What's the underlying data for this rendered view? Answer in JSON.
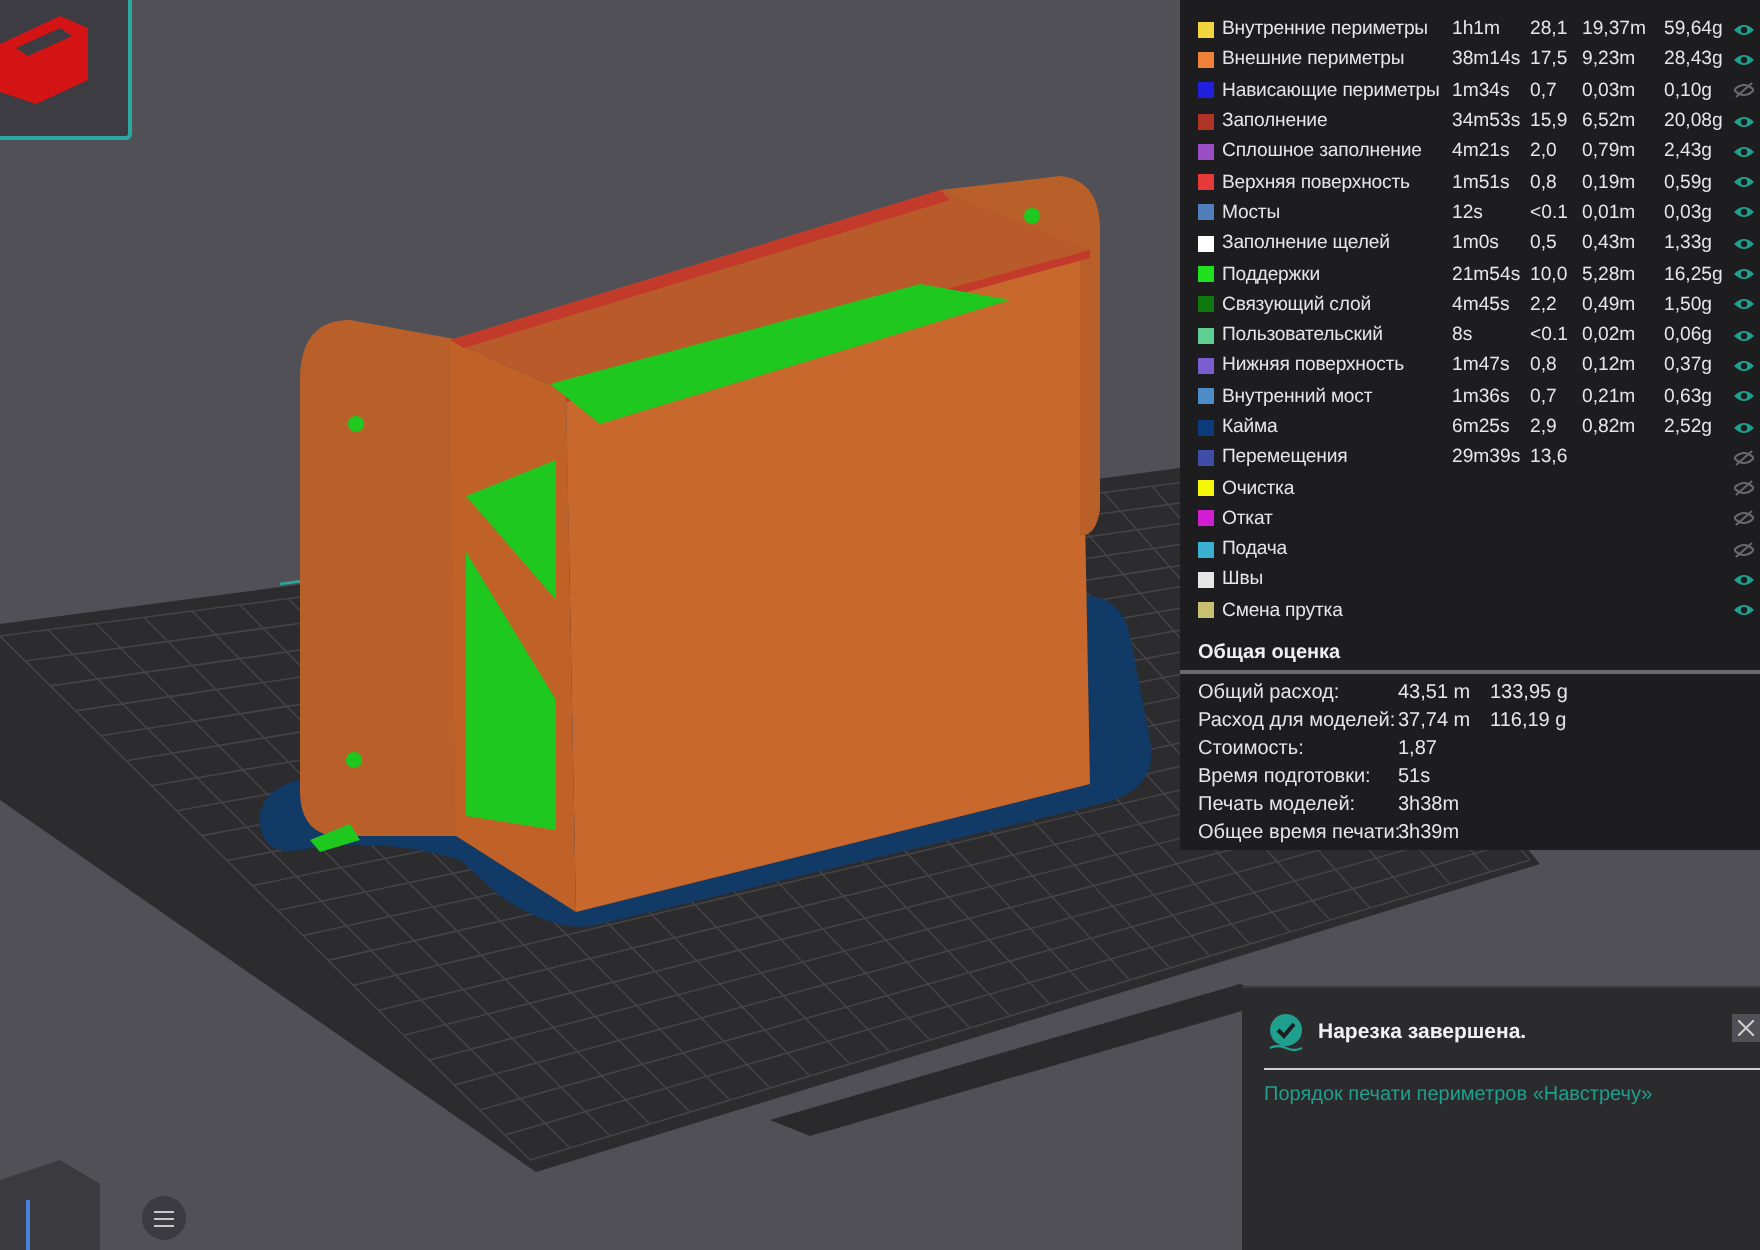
{
  "legend": {
    "rows": [
      {
        "name": "Внутренние периметры",
        "color": "#f2d43c",
        "time": "1h1m",
        "percent": "28,1",
        "length": "19,37m",
        "weight": "59,64g",
        "visible": true
      },
      {
        "name": "Внешние периметры",
        "color": "#f0823c",
        "time": "38m14s",
        "percent": "17,5",
        "length": "9,23m",
        "weight": "28,43g",
        "visible": true
      },
      {
        "name": "Нависающие периметры",
        "color": "#1f1fe0",
        "time": "1m34s",
        "percent": "0,7",
        "length": "0,03m",
        "weight": "0,10g",
        "visible": false
      },
      {
        "name": "Заполнение",
        "color": "#b03328",
        "time": "34m53s",
        "percent": "15,9",
        "length": "6,52m",
        "weight": "20,08g",
        "visible": true
      },
      {
        "name": "Сплошное заполнение",
        "color": "#9a4ec4",
        "time": "4m21s",
        "percent": "2,0",
        "length": "0,79m",
        "weight": "2,43g",
        "visible": true
      },
      {
        "name": "Верхняя поверхность",
        "color": "#e63a3a",
        "time": "1m51s",
        "percent": "0,8",
        "length": "0,19m",
        "weight": "0,59g",
        "visible": true
      },
      {
        "name": "Мосты",
        "color": "#4f7fb8",
        "time": "12s",
        "percent": "<0.1",
        "length": "0,01m",
        "weight": "0,03g",
        "visible": true
      },
      {
        "name": "Заполнение щелей",
        "color": "#ffffff",
        "time": "1m0s",
        "percent": "0,5",
        "length": "0,43m",
        "weight": "1,33g",
        "visible": true
      },
      {
        "name": "Поддержки",
        "color": "#1ee01e",
        "time": "21m54s",
        "percent": "10,0",
        "length": "5,28m",
        "weight": "16,25g",
        "visible": true
      },
      {
        "name": "Связующий слой",
        "color": "#0f7a0f",
        "time": "4m45s",
        "percent": "2,2",
        "length": "0,49m",
        "weight": "1,50g",
        "visible": true
      },
      {
        "name": "Пользовательский",
        "color": "#5ecf8e",
        "time": "8s",
        "percent": "<0.1",
        "length": "0,02m",
        "weight": "0,06g",
        "visible": true
      },
      {
        "name": "Нижняя поверхность",
        "color": "#7a5ed0",
        "time": "1m47s",
        "percent": "0,8",
        "length": "0,12m",
        "weight": "0,37g",
        "visible": true
      },
      {
        "name": "Внутренний мост",
        "color": "#4d8cc8",
        "time": "1m36s",
        "percent": "0,7",
        "length": "0,21m",
        "weight": "0,63g",
        "visible": true
      },
      {
        "name": "Кайма",
        "color": "#0d3a78",
        "time": "6m25s",
        "percent": "2,9",
        "length": "0,82m",
        "weight": "2,52g",
        "visible": true
      },
      {
        "name": "Перемещения",
        "color": "#3e4ea8",
        "time": "29m39s",
        "percent": "13,6",
        "visible": false
      },
      {
        "name": "Очистка",
        "color": "#f5f50a",
        "visible": false
      },
      {
        "name": "Откат",
        "color": "#d21ed2",
        "visible": false
      },
      {
        "name": "Подача",
        "color": "#3ab0d0",
        "visible": false
      },
      {
        "name": "Швы",
        "color": "#e6e6e6",
        "visible": true
      },
      {
        "name": "Смена прутка",
        "color": "#c8c070",
        "visible": true
      }
    ]
  },
  "summary": {
    "title": "Общая оценка",
    "rows": [
      {
        "label": "Общий расход:",
        "values": [
          "43,51 m",
          "133,95 g"
        ]
      },
      {
        "label": "Расход для моделей:",
        "values": [
          "37,74 m",
          "116,19 g"
        ]
      },
      {
        "label": "Стоимость:",
        "values": [
          "1,87"
        ]
      },
      {
        "label": "Время подготовки:",
        "values": [
          "51s"
        ]
      },
      {
        "label": "Печать моделей:",
        "values": [
          "3h38m"
        ]
      },
      {
        "label": "Общее время печати:",
        "values": [
          "3h39m"
        ]
      }
    ]
  },
  "notification": {
    "title": "Нарезка завершена.",
    "link": "Порядок печати периметров «Навстречу»"
  }
}
